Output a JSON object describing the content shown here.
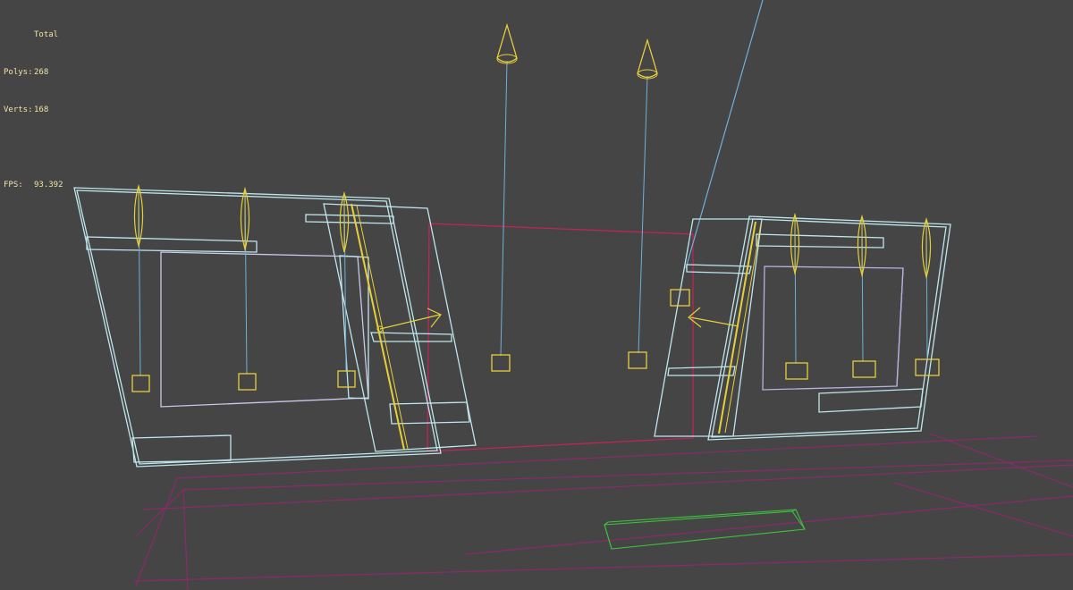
{
  "stats": {
    "header": "Total",
    "polys_label": "Polys:",
    "polys_value": "268",
    "verts_label": "Verts:",
    "verts_value": "168",
    "fps_label": "FPS:",
    "fps_value": "93.392"
  },
  "colors": {
    "background": "#454545",
    "stats_text": "#f1e3a6",
    "frame_wire": "#bfe6ec",
    "light_gizmo": "#e6cf3a",
    "light_line": "#6fb0d8",
    "room_wire": "#a0286a",
    "selected_box": "#3fbf3f",
    "inner_wire": "#b7b0e0"
  }
}
